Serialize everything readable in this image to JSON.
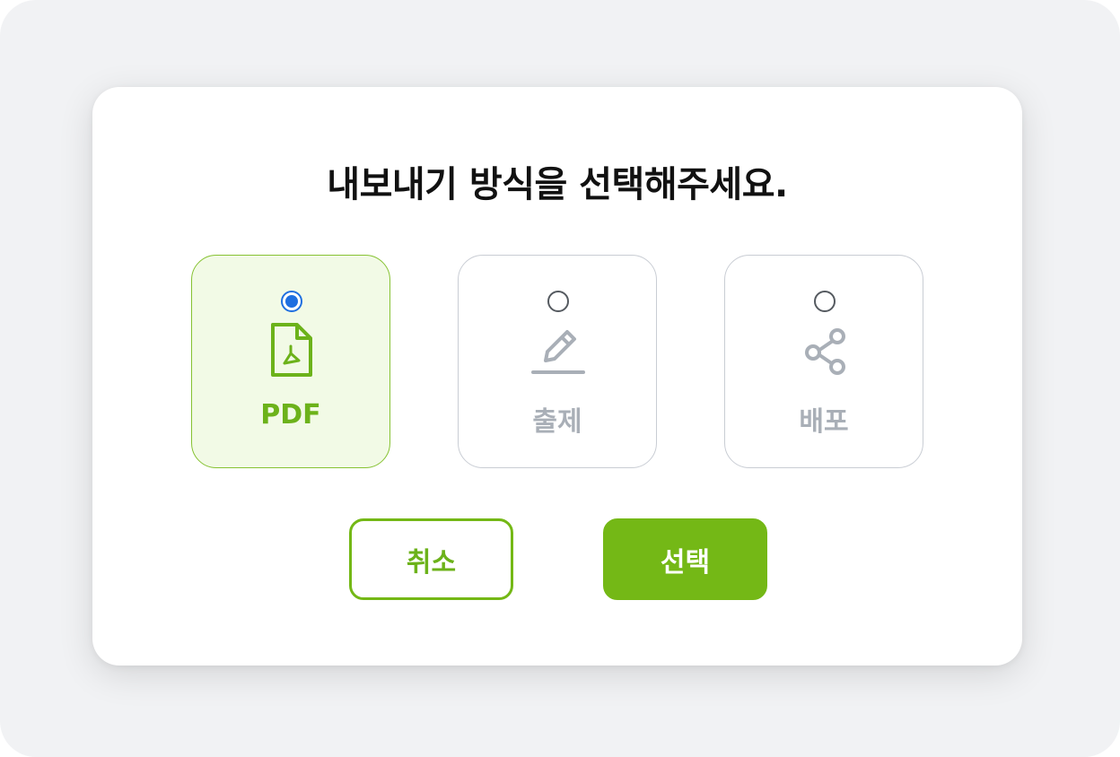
{
  "dialog": {
    "title": "내보내기 방식을 선택해주세요."
  },
  "options": [
    {
      "label": "PDF",
      "icon": "pdf-file-icon",
      "selected": true
    },
    {
      "label": "출제",
      "icon": "pencil-icon",
      "selected": false
    },
    {
      "label": "배포",
      "icon": "share-icon",
      "selected": false
    }
  ],
  "buttons": {
    "cancel_label": "취소",
    "confirm_label": "선택"
  },
  "colors": {
    "accent": "#74b816",
    "accent_text": "#6cb21a",
    "selected_bg": "#f2fae6",
    "radio_checked": "#1f6fe0",
    "inactive": "#a9afb7"
  }
}
